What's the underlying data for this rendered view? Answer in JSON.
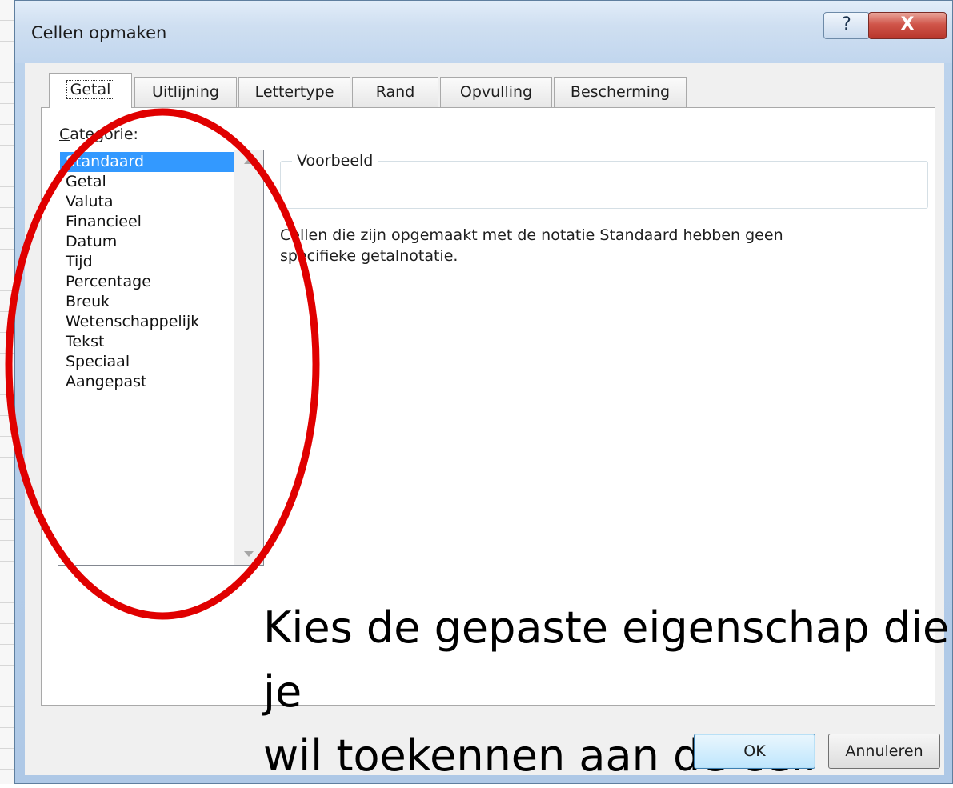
{
  "window": {
    "title": "Cellen opmaken",
    "help_label": "?",
    "close_label": "X"
  },
  "tabs": [
    {
      "label": "Getal",
      "active": true
    },
    {
      "label": "Uitlijning",
      "active": false
    },
    {
      "label": "Lettertype",
      "active": false
    },
    {
      "label": "Rand",
      "active": false
    },
    {
      "label": "Opvulling",
      "active": false
    },
    {
      "label": "Bescherming",
      "active": false
    }
  ],
  "category": {
    "label_underlined": "C",
    "label_rest": "ategorie:",
    "items": [
      {
        "label": "Standaard",
        "selected": true
      },
      {
        "label": "Getal",
        "selected": false
      },
      {
        "label": "Valuta",
        "selected": false
      },
      {
        "label": "Financieel",
        "selected": false
      },
      {
        "label": "Datum",
        "selected": false
      },
      {
        "label": "Tijd",
        "selected": false
      },
      {
        "label": "Percentage",
        "selected": false
      },
      {
        "label": "Breuk",
        "selected": false
      },
      {
        "label": "Wetenschappelijk",
        "selected": false
      },
      {
        "label": "Tekst",
        "selected": false
      },
      {
        "label": "Speciaal",
        "selected": false
      },
      {
        "label": "Aangepast",
        "selected": false
      }
    ]
  },
  "preview": {
    "legend": "Voorbeeld",
    "value": ""
  },
  "description": {
    "line1": "Cellen die zijn opgemaakt met de notatie Standaard hebben geen",
    "line2": "specifieke getalnotatie."
  },
  "annotation": {
    "line1": "Kies de gepaste eigenschap die je",
    "line2": "wil toekennen aan de cel."
  },
  "buttons": {
    "ok": "OK",
    "cancel": "Annuleren"
  },
  "colors": {
    "selection": "#3399ff",
    "annotation_ellipse": "#e00000"
  }
}
